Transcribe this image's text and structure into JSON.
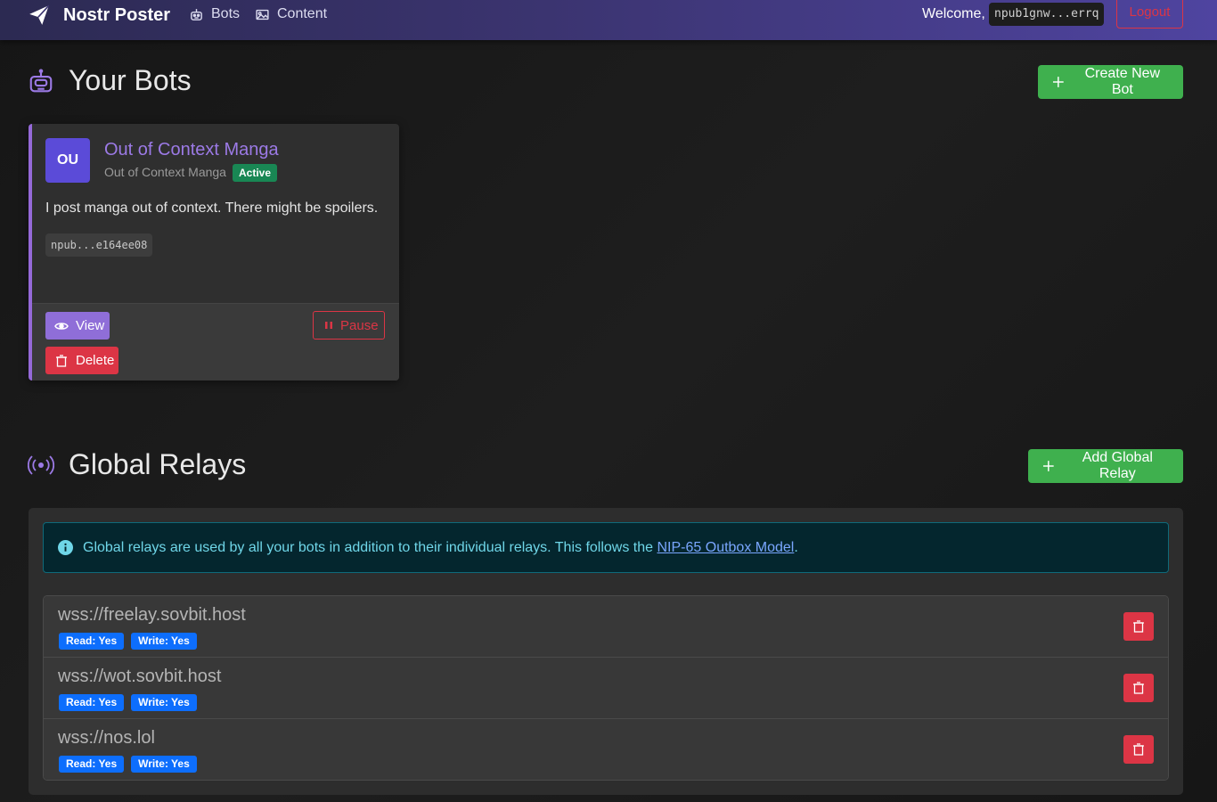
{
  "navbar": {
    "brand": "Nostr Poster",
    "links": [
      {
        "label": "Bots",
        "icon": "robot-icon"
      },
      {
        "label": "Content",
        "icon": "image-icon"
      }
    ],
    "welcome": "Welcome,",
    "user_npub": "npub1gnw...errq",
    "logout": "Logout"
  },
  "bots_section": {
    "title": "Your Bots",
    "create_button": "Create New Bot",
    "bots": [
      {
        "initials": "OU",
        "name": "Out of Context Manga",
        "display_name": "Out of Context Manga",
        "status": "Active",
        "description": "I post manga out of context. There might be spoilers.",
        "npub": "npub...e164ee08",
        "actions": {
          "view": "View",
          "pause": "Pause",
          "delete": "Delete"
        }
      }
    ]
  },
  "relays_section": {
    "title": "Global Relays",
    "add_button": "Add Global Relay",
    "info_text": "Global relays are used by all your bots in addition to their individual relays. This follows the",
    "info_link": "NIP-65 Outbox Model",
    "info_suffix": ".",
    "relays": [
      {
        "url": "wss://freelay.sovbit.host",
        "read": "Read: Yes",
        "write": "Write: Yes"
      },
      {
        "url": "wss://wot.sovbit.host",
        "read": "Read: Yes",
        "write": "Write: Yes"
      },
      {
        "url": "wss://nos.lol",
        "read": "Read: Yes",
        "write": "Write: Yes"
      }
    ]
  },
  "colors": {
    "accent": "#9569d8",
    "success": "#3fb04e",
    "danger": "#dc3545",
    "primary": "#0d6efd",
    "info": "#6fd6e8"
  }
}
